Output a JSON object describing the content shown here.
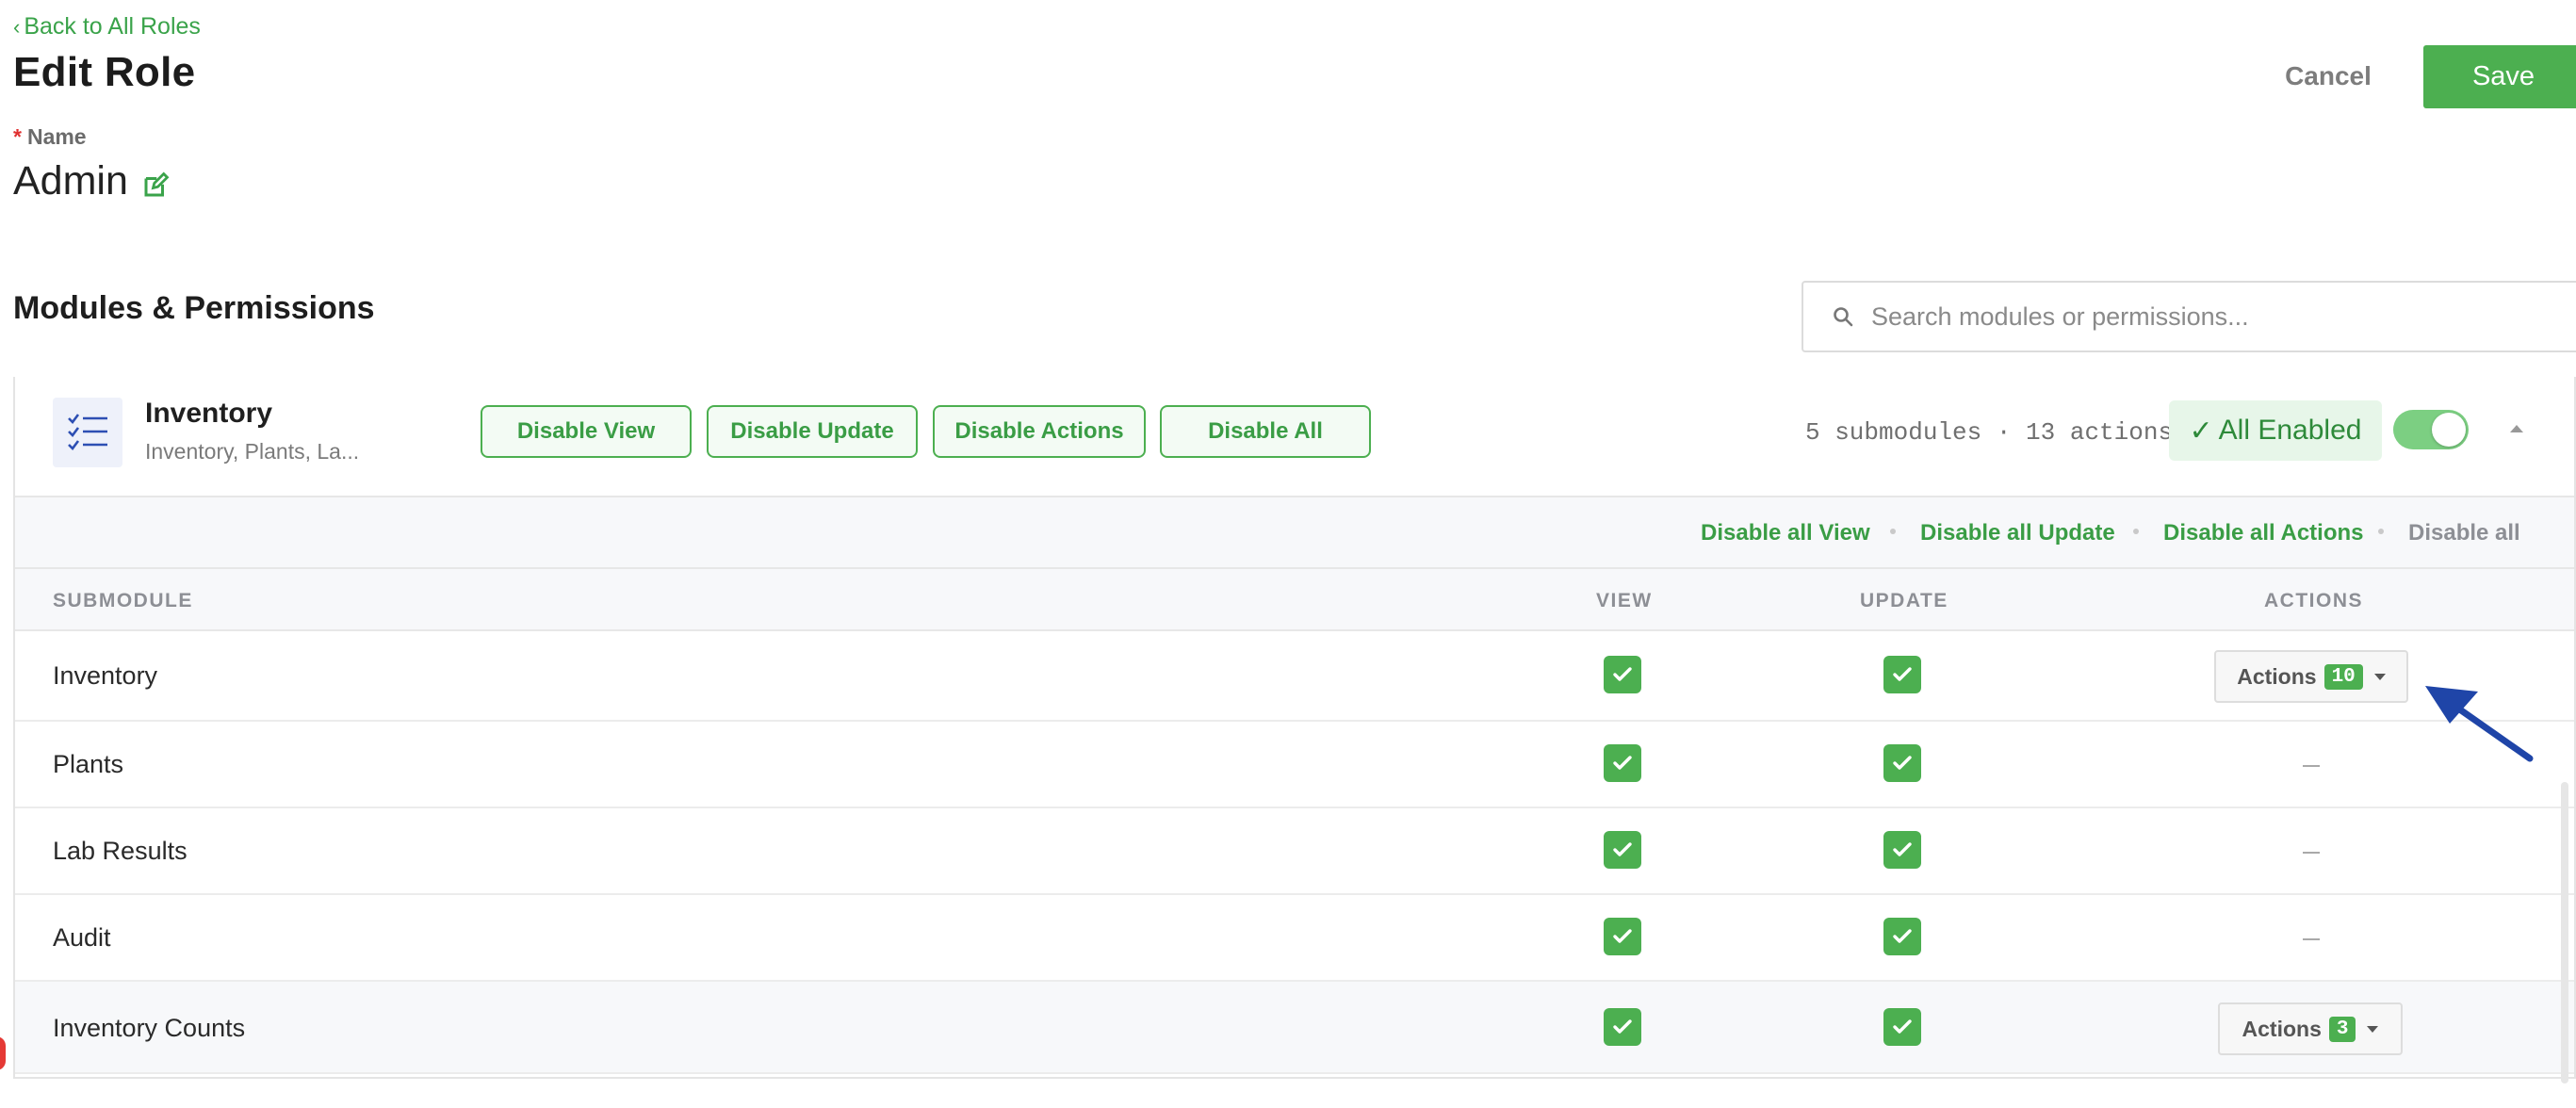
{
  "header": {
    "back_label": "Back to All Roles",
    "title": "Edit Role",
    "cancel_label": "Cancel",
    "save_label": "Save"
  },
  "name_field": {
    "label": "Name",
    "required_mark": "*",
    "value": "Admin"
  },
  "section": {
    "title": "Modules & Permissions",
    "search_placeholder": "Search modules or permissions..."
  },
  "module": {
    "name": "Inventory",
    "subtitle": "Inventory, Plants, La...",
    "buttons": [
      "Disable View",
      "Disable Update",
      "Disable Actions",
      "Disable All"
    ],
    "counts": "5 submodules · 13 actions",
    "status": "All Enabled",
    "status_check": "✓",
    "toggle_on": true,
    "bulk_links": [
      "Disable all View",
      "Disable all Update",
      "Disable all Actions",
      "Disable all"
    ],
    "columns": [
      "SUBMODULE",
      "VIEW",
      "UPDATE",
      "ACTIONS"
    ],
    "rows": [
      {
        "name": "Inventory",
        "view": true,
        "update": true,
        "actions_label": "Actions",
        "actions_count": "10"
      },
      {
        "name": "Plants",
        "view": true,
        "update": true,
        "actions_label": null,
        "actions_count": null
      },
      {
        "name": "Lab Results",
        "view": true,
        "update": true,
        "actions_label": null,
        "actions_count": null
      },
      {
        "name": "Audit",
        "view": true,
        "update": true,
        "actions_label": null,
        "actions_count": null
      },
      {
        "name": "Inventory Counts",
        "view": true,
        "update": true,
        "actions_label": "Actions",
        "actions_count": "3"
      }
    ]
  },
  "colors": {
    "accent": "#4caf50",
    "accent_text": "#3a9d45",
    "arrow": "#1f45a8"
  }
}
